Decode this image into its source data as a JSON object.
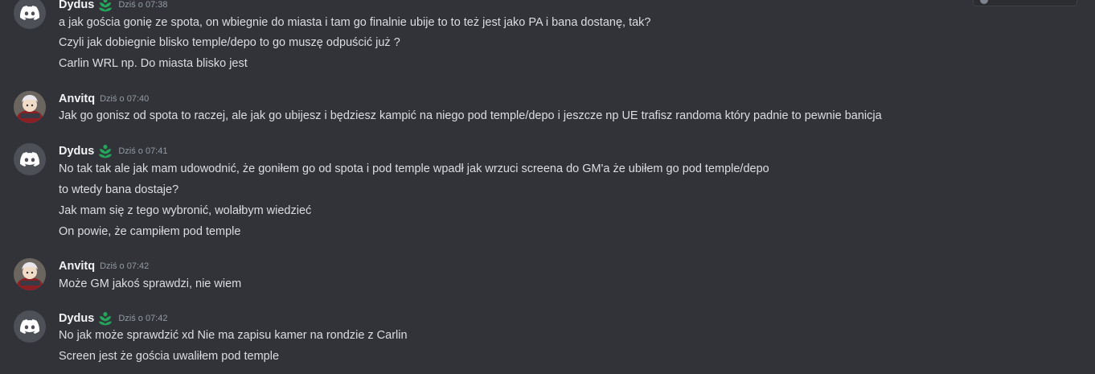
{
  "messages": [
    {
      "author": "Dydus",
      "time": "Dziś o 07:38",
      "avatar": "discord-logo",
      "lines": [
        "a jak gościa gonię ze spota, on wbiegnie do miasta i tam go finalnie ubije to to też jest jako PA i bana dostanę, tak?",
        "Czyli jak dobiegnie blisko temple/depo to go muszę odpuścić już ?",
        "Carlin WRL np. Do miasta blisko jest"
      ]
    },
    {
      "author": "Anvitq",
      "time": "Dziś o 07:40",
      "avatar": "character-photo",
      "lines": [
        "Jak go gonisz od spota to raczej, ale jak go ubijesz i będziesz kampić na niego pod temple/depo i jeszcze np UE trafisz randoma który padnie to pewnie banicja"
      ]
    },
    {
      "author": "Dydus",
      "time": "Dziś o 07:41",
      "avatar": "discord-logo",
      "lines": [
        "No tak tak ale jak mam udowodnić, że goniłem go od spota i pod temple wpadł jak wrzuci screena do GM'a że ubiłem go pod temple/depo",
        "to wtedy bana dostaje?",
        "Jak mam się z tego wybronić, wolałbym wiedzieć",
        "On powie, że campiłem pod temple"
      ]
    },
    {
      "author": "Anvitq",
      "time": "Dziś o 07:42",
      "avatar": "character-photo",
      "lines": [
        "Może GM jakoś sprawdzi, nie wiem"
      ]
    },
    {
      "author": "Dydus",
      "time": "Dziś o 07:42",
      "avatar": "discord-logo",
      "lines": [
        "No jak może sprawdzić xd Nie ma zapisu kamer na rondzie z Carlin",
        "Screen jest że gościa uwaliłem pod temple"
      ]
    }
  ],
  "colors": {
    "background": "#323339",
    "username": "#f2f3f5",
    "timestamp": "#949ba4",
    "text": "#dbdee1",
    "badge": "#23a55a"
  },
  "icons": {
    "badge": "green-leaf-badge-icon",
    "discord": "discord-logo-icon"
  }
}
